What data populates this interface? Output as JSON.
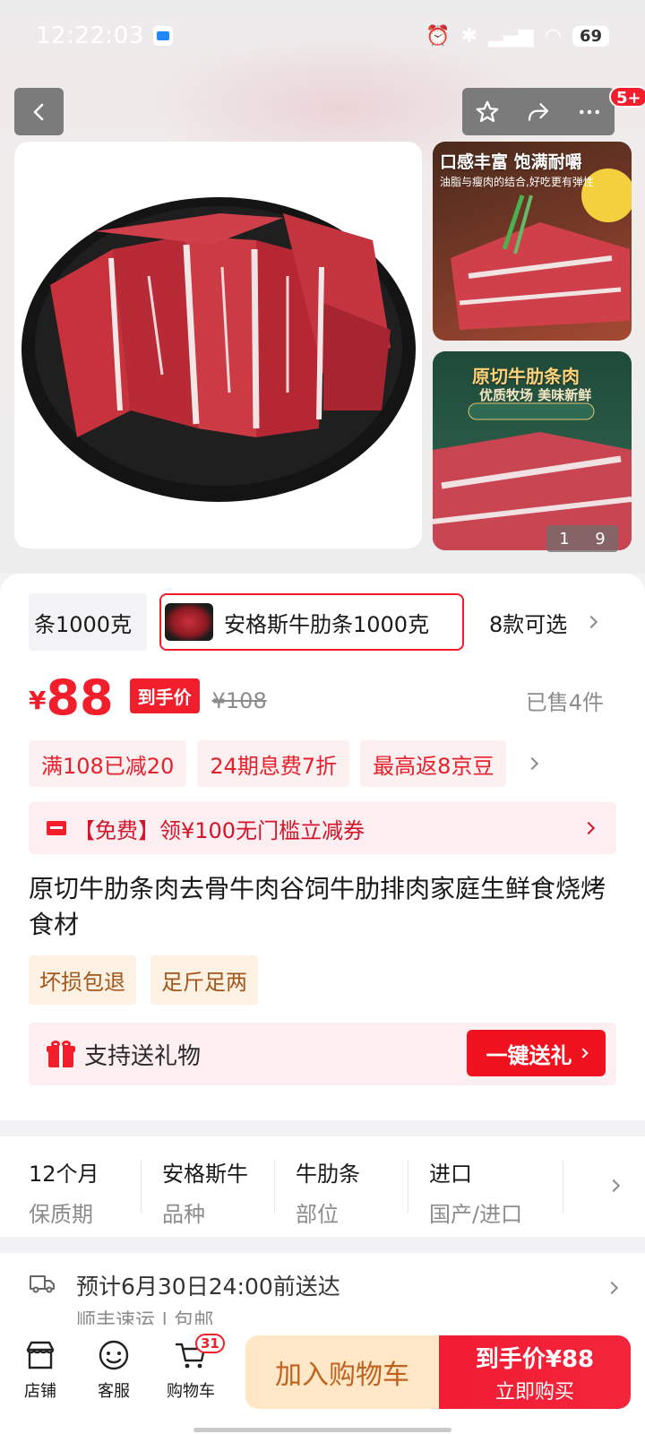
{
  "status_bar": {
    "time": "12:22:03",
    "battery": "69"
  },
  "header": {
    "badge": "5+"
  },
  "gallery": {
    "thumb1_caption": "口感丰富 饱满耐嚼",
    "thumb1_sub": "油脂与瘦肉的结合,好吃更有弹性",
    "thumb2_caption": "原切牛肋条肉",
    "thumb2_sub": "优质牧场 美味新鲜",
    "counter_current": "1",
    "counter_total": "9"
  },
  "variants": {
    "partial": "条1000克",
    "selected": "安格斯牛肋条1000克",
    "more": "8款可选"
  },
  "price": {
    "symbol": "¥",
    "amount": "88",
    "tag": "到手价",
    "original": "¥108",
    "sold": "已售4件"
  },
  "promos": [
    "满108已减20",
    "24期息费7折",
    "最高返8京豆"
  ],
  "coupon": {
    "text": "【免费】领¥100无门槛立减券"
  },
  "product": {
    "title": "原切牛肋条肉去骨牛肉谷饲牛肋排肉家庭生鲜食烧烤食材",
    "tags": [
      "坏损包退",
      "足斤足两"
    ]
  },
  "gift": {
    "label": "支持送礼物",
    "button": "一键送礼"
  },
  "specs": [
    {
      "value": "12个月",
      "key": "保质期"
    },
    {
      "value": "安格斯牛",
      "key": "品种"
    },
    {
      "value": "牛肋条",
      "key": "部位"
    },
    {
      "value": "进口",
      "key": "国产/进口"
    }
  ],
  "delivery": {
    "text": "预计6月30日24:00前送达",
    "sub": "顺丰速运 | 包邮"
  },
  "bottom_nav": {
    "store": "店铺",
    "service": "客服",
    "cart": "购物车",
    "cart_count": "31",
    "add_to_cart": "加入购物车",
    "buy_line1": "到手价¥88",
    "buy_line2": "立即购买"
  },
  "colors": {
    "accent": "#f31e2c",
    "gift_button": "#f0131f",
    "cart_button_bg": "#ffe7c8"
  },
  "icons": [
    "back-icon",
    "star-icon",
    "share-icon",
    "more-icon",
    "coupon-icon",
    "gift-icon",
    "truck-icon",
    "store-icon",
    "service-icon",
    "cart-icon"
  ]
}
